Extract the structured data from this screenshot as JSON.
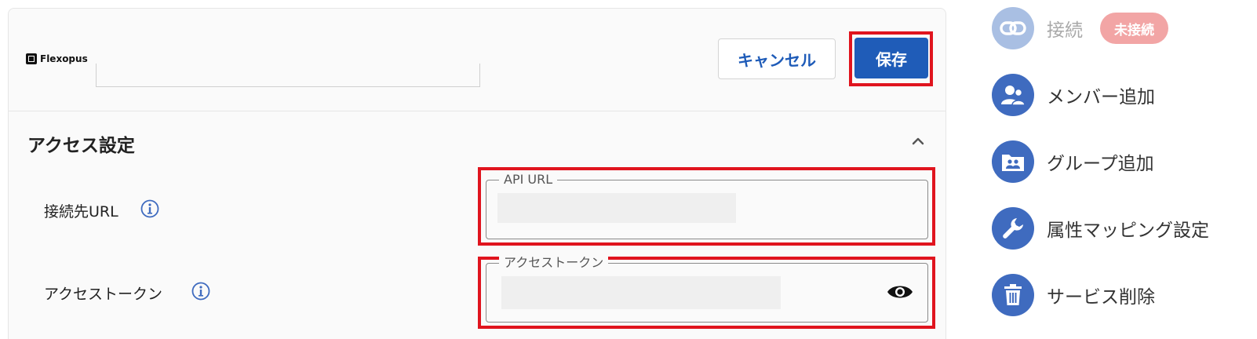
{
  "brand": {
    "name": "Flexopus"
  },
  "header": {
    "cancel_label": "キャンセル",
    "save_label": "保存"
  },
  "section": {
    "title": "アクセス設定",
    "fields": [
      {
        "label": "接続先URL",
        "legend": "API URL",
        "value": ""
      },
      {
        "label": "アクセストークン",
        "legend": "アクセストークン",
        "value": ""
      }
    ]
  },
  "menu": {
    "connect": {
      "label": "接続",
      "badge": "未接続"
    },
    "add_member": {
      "label": "メンバー追加"
    },
    "add_group": {
      "label": "グループ追加"
    },
    "attribute_mapping": {
      "label": "属性マッピング設定"
    },
    "delete_service": {
      "label": "サービス削除"
    }
  },
  "colors": {
    "primary": "#1f5cb8",
    "menu_icon": "#3f6bbf",
    "menu_icon_disabled": "#a9bfe3",
    "highlight": "#e0141e",
    "badge": "#f2a5a5"
  },
  "icons": {
    "connect": "link-icon",
    "add_member": "users-icon",
    "add_group": "folder-group-icon",
    "attribute_mapping": "wrench-icon",
    "delete_service": "trash-icon",
    "info": "info-icon",
    "password_visibility": "eye-icon",
    "collapse": "chevron-up-icon"
  }
}
